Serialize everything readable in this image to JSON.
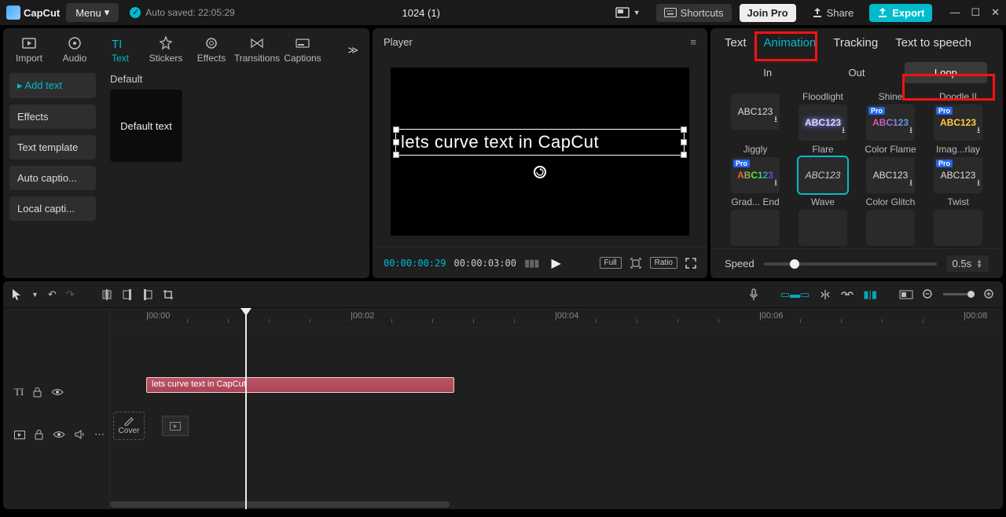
{
  "titlebar": {
    "app_name": "CapCut",
    "menu_label": "Menu",
    "autosaved_label": "Auto saved: 22:05:29",
    "project_title": "1024 (1)",
    "shortcuts_label": "Shortcuts",
    "joinpro_label": "Join Pro",
    "share_label": "Share",
    "export_label": "Export"
  },
  "library": {
    "tabs": {
      "import": "Import",
      "audio": "Audio",
      "text": "Text",
      "stickers": "Stickers",
      "effects": "Effects",
      "transitions": "Transitions",
      "captions": "Captions"
    },
    "side": {
      "add_text": "Add text",
      "effects": "Effects",
      "text_template": "Text template",
      "auto_captions": "Auto captio...",
      "local_captions": "Local capti..."
    },
    "section_header": "Default",
    "text_card_label": "Default text"
  },
  "player": {
    "title": "Player",
    "text_content": "lets curve text in CapCut",
    "current_tc": "00:00:00:29",
    "total_tc": "00:00:03:00",
    "full_label": "Full",
    "ratio_label": "Ratio"
  },
  "inspector": {
    "tabs": {
      "text": "Text",
      "animation": "Animation",
      "tracking": "Tracking",
      "tts": "Text to speech"
    },
    "subtabs": {
      "in": "In",
      "out": "Out",
      "loop": "Loop"
    },
    "speed_label": "Speed",
    "speed_value": "0.5s",
    "animations_row1": [
      {
        "label": "",
        "text": "ABC123",
        "cls": "",
        "pro": false,
        "dl": true
      },
      {
        "label": "Floodlight",
        "text": "ABC123",
        "cls": "txt-flood",
        "pro": false,
        "dl": true
      },
      {
        "label": "Shine",
        "text": "ABC123",
        "cls": "txt-shine",
        "pro": true,
        "dl": true
      },
      {
        "label": "Doodle II",
        "text": "ABC123",
        "cls": "txt-doodle",
        "pro": true,
        "dl": true
      }
    ],
    "animations_row2": [
      {
        "label": "Jiggly",
        "text": "ABC123",
        "cls": "txt-jiggly",
        "pro": true,
        "dl": true
      },
      {
        "label": "Flare",
        "text": "ABC123",
        "cls": "txt-plain",
        "pro": false,
        "dl": false,
        "selected": true
      },
      {
        "label": "Color Flame",
        "text": "ABC123",
        "cls": "",
        "pro": false,
        "dl": true
      },
      {
        "label": "Imag...rlay",
        "text": "ABC123",
        "cls": "",
        "pro": true,
        "dl": true
      }
    ],
    "animations_row3": [
      {
        "label": "Grad... End",
        "text": "",
        "cls": "",
        "pro": false,
        "dl": false
      },
      {
        "label": "Wave",
        "text": "",
        "cls": "",
        "pro": false,
        "dl": false
      },
      {
        "label": "Color Glitch",
        "text": "",
        "cls": "",
        "pro": false,
        "dl": false
      },
      {
        "label": "Twist",
        "text": "",
        "cls": "",
        "pro": false,
        "dl": false
      }
    ]
  },
  "timeline": {
    "ticks": [
      "|00:00",
      "|00:02",
      "|00:04",
      "|00:06",
      "|00:08"
    ],
    "clip_text": "lets curve text in CapCut",
    "cover_label": "Cover"
  }
}
